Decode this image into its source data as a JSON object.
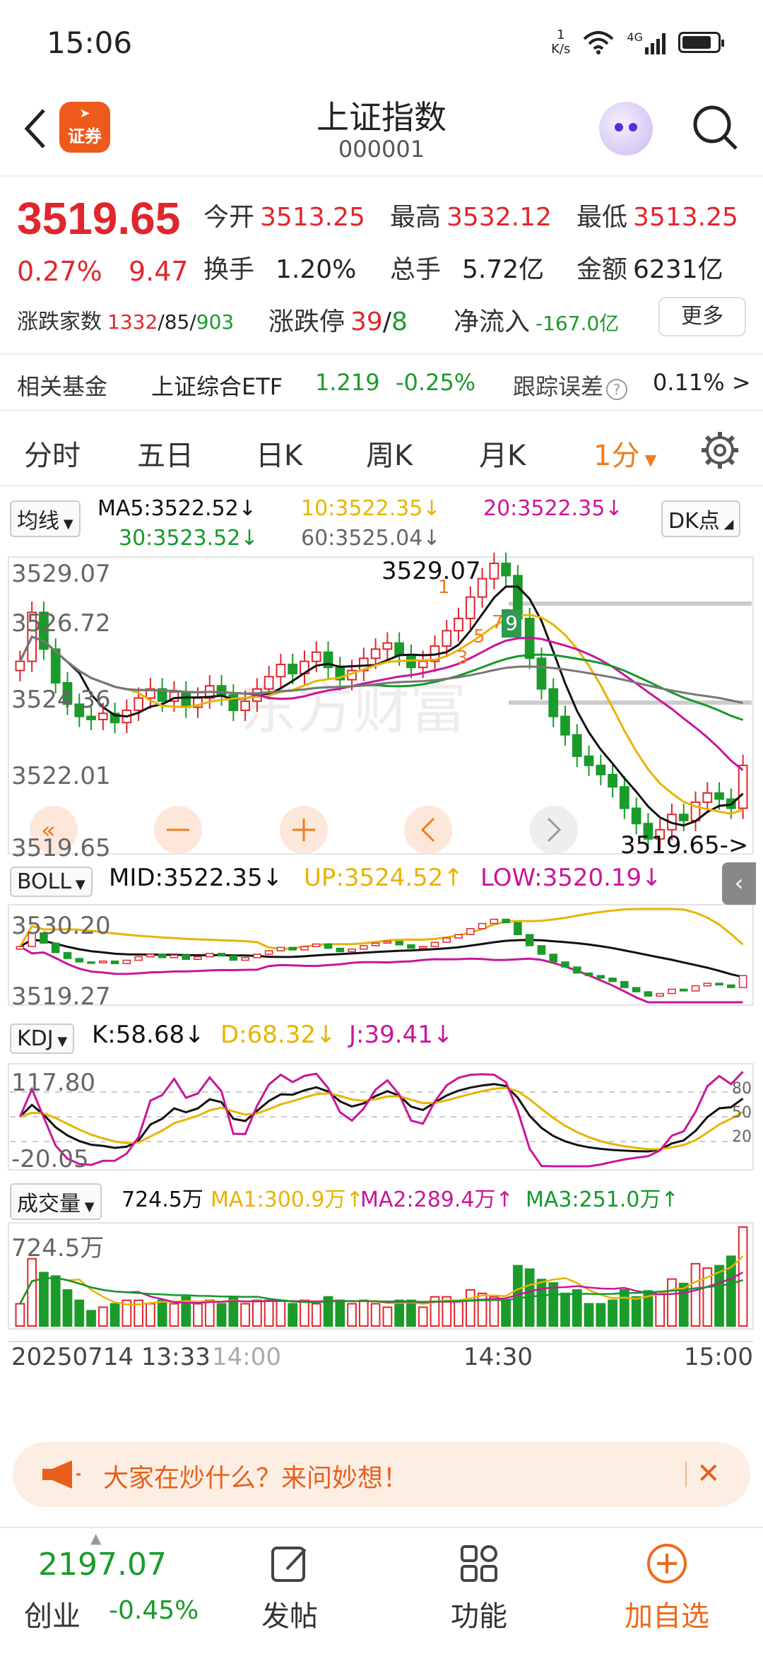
{
  "status": {
    "time": "15:06",
    "speed_value": "1",
    "speed_unit": "K/s",
    "net": "4G"
  },
  "header": {
    "logo_text": "证券",
    "title": "上证指数",
    "code": "000001"
  },
  "quote": {
    "price": "3519.65",
    "pct": "0.27%",
    "change": "9.47",
    "open_label": "今开",
    "open": "3513.25",
    "high_label": "最高",
    "high": "3532.12",
    "low_label": "最低",
    "low": "3513.25",
    "turnover_label": "换手",
    "turnover": "1.20%",
    "volume_label": "总手",
    "volume": "5.72亿",
    "amount_label": "金额",
    "amount": "6231亿",
    "breadth_label": "涨跌家数",
    "breadth_up": "1332",
    "breadth_flat": "/85/",
    "breadth_down": "903",
    "limit_label": "涨跌停",
    "limit_up": "39",
    "limit_sep": "/",
    "limit_down": "8",
    "netflow_label": "净流入",
    "netflow": "-167.0亿",
    "more": "更多"
  },
  "fund": {
    "label": "相关基金",
    "name": "上证综合ETF",
    "price": "1.219",
    "pct": "-0.25%",
    "err_label": "跟踪误差",
    "err": "0.11%",
    "arrow": ">"
  },
  "tabs": [
    {
      "label": "分时"
    },
    {
      "label": "五日"
    },
    {
      "label": "日K"
    },
    {
      "label": "周K"
    },
    {
      "label": "月K"
    },
    {
      "label": "1分"
    }
  ],
  "ma": {
    "toggle": "均线",
    "ma5": "MA5:3522.52↓",
    "ma10": "10:3522.35↓",
    "ma20": "20:3522.35↓",
    "ma30": "30:3523.52↓",
    "ma60": "60:3525.04↓",
    "dk": "DK点"
  },
  "main_chart": {
    "y_top": "3529.07",
    "y_2": "3526.72",
    "y_3": "3524.36",
    "y_4": "3522.01",
    "y_bottom": "3519.65",
    "high_mark": "3529.07",
    "low_mark": "3519.65->",
    "sig_1": "1",
    "sig_3": "3",
    "sig_5": "5",
    "sig_7": "7",
    "sig_9": "9"
  },
  "boll": {
    "toggle": "BOLL",
    "mid": "MID:3522.35↓",
    "up": "UP:3524.52↑",
    "low": "LOW:3520.19↓",
    "y_top": "3530.20",
    "y_bottom": "3519.27"
  },
  "kdj": {
    "toggle": "KDJ",
    "k": "K:58.68↓",
    "d": "D:68.32↓",
    "j": "J:39.41↓",
    "y_top": "117.80",
    "y_bottom": "-20.05",
    "r80": "80",
    "r50": "50",
    "r20": "20"
  },
  "vol": {
    "toggle": "成交量",
    "value": "724.5万",
    "ma1": "MA1:300.9万↑",
    "ma2": "MA2:289.4万↑",
    "ma3": "MA3:251.0万↑",
    "y_top": "724.5万"
  },
  "time_axis": {
    "start": "20250714 13:33",
    "t1": "14:00",
    "t2": "14:30",
    "t3": "15:00"
  },
  "banner": {
    "text": "大家在炒什么？来问妙想！"
  },
  "bottom": {
    "index_value": "2197.07",
    "index_name": "创业",
    "index_pct": "-0.45%",
    "post": "发帖",
    "func": "功能",
    "add": "加自选"
  },
  "colors": {
    "red": "#e0262d",
    "green": "#1a9b2a",
    "orange": "#ee7d1f",
    "ma5": "#111111",
    "ma10": "#e8b400",
    "ma20": "#c8169a",
    "ma30": "#139a29",
    "ma60": "#777777"
  },
  "chart_data": {
    "type": "candlestick",
    "y_range": [
      3519.65,
      3529.07
    ],
    "closes": [
      3525.8,
      3527.4,
      3526.2,
      3525.1,
      3524.4,
      3524.0,
      3523.9,
      3524.1,
      3523.8,
      3524.2,
      3524.6,
      3524.9,
      3524.5,
      3524.8,
      3524.3,
      3524.6,
      3525.0,
      3524.7,
      3524.2,
      3524.5,
      3524.9,
      3525.3,
      3525.7,
      3525.4,
      3525.8,
      3526.1,
      3525.6,
      3525.2,
      3525.5,
      3525.9,
      3526.2,
      3526.4,
      3526.0,
      3525.6,
      3525.8,
      3526.3,
      3526.8,
      3527.2,
      3527.9,
      3528.5,
      3529.0,
      3528.6,
      3527.2,
      3525.9,
      3524.9,
      3524.0,
      3523.4,
      3522.7,
      3522.4,
      3522.1,
      3521.7,
      3521.0,
      3520.5,
      3520.0,
      3520.3,
      3520.8,
      3520.6,
      3521.2,
      3521.5,
      3521.3,
      3521.0,
      3522.4
    ]
  }
}
